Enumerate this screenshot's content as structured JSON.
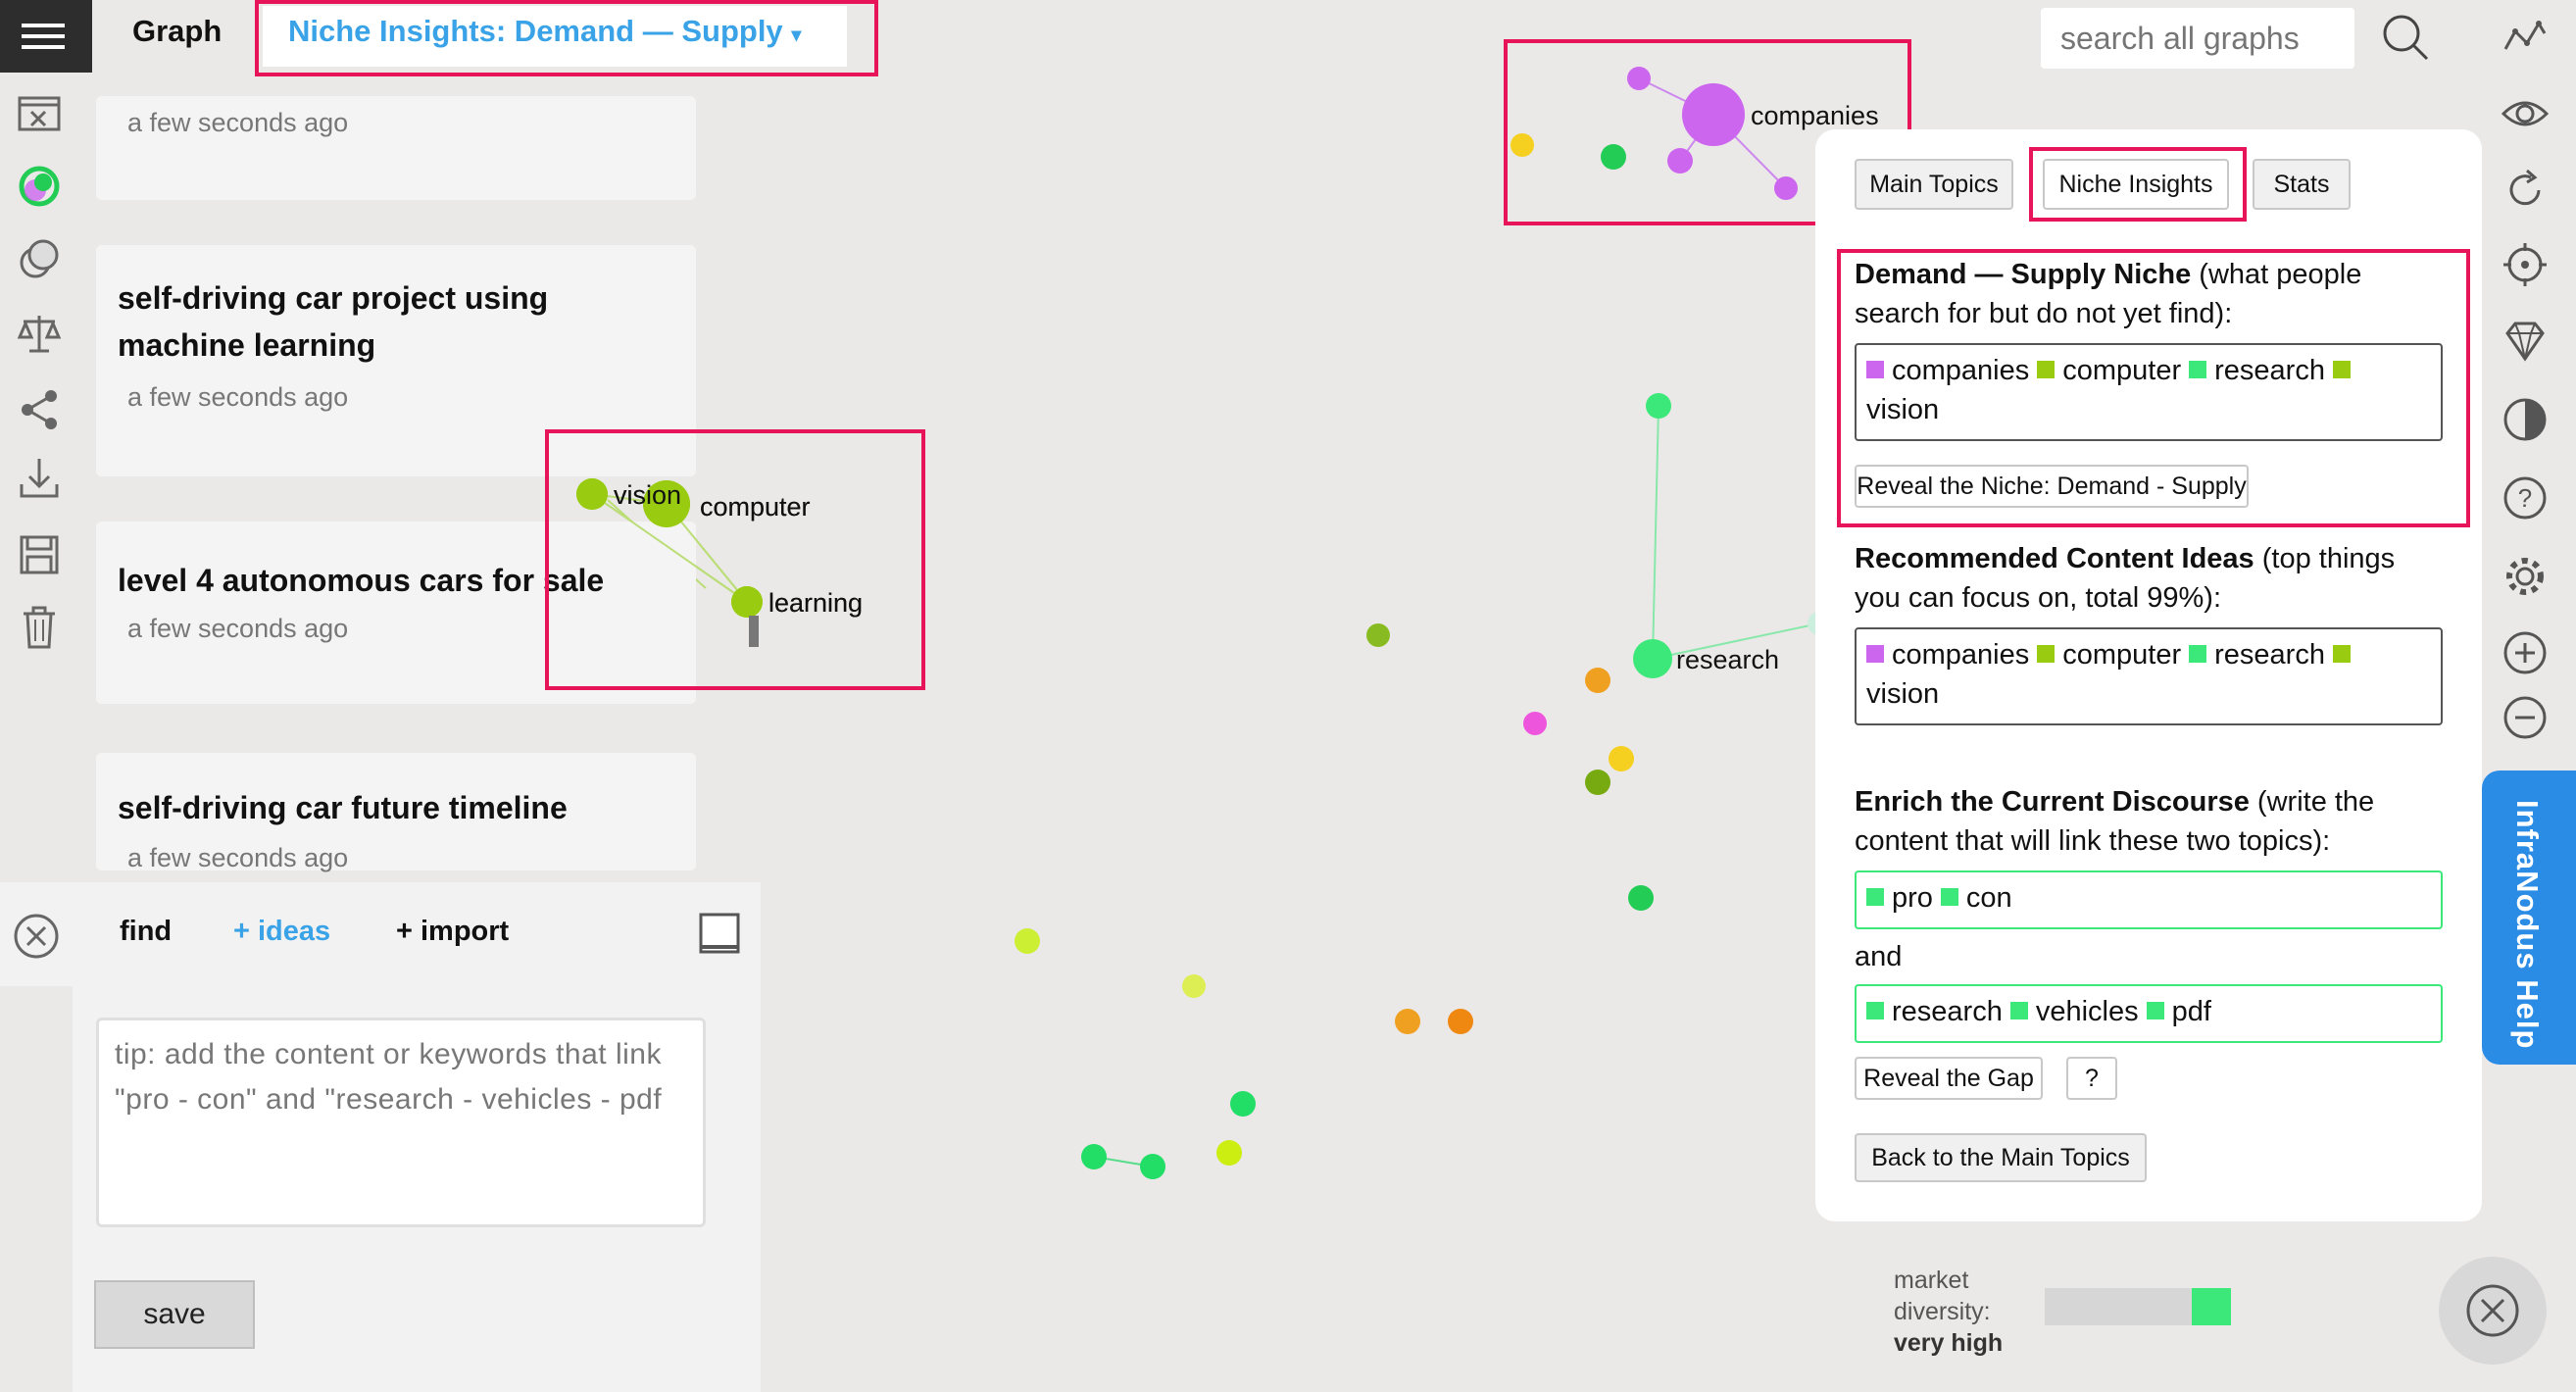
{
  "header": {
    "graph_label": "Graph",
    "graph_title": "Niche Insights: Demand — Supply",
    "search_placeholder": "search all graphs"
  },
  "cards": [
    {
      "title": "",
      "time": "a few seconds ago"
    },
    {
      "title_line1": "self-driving car project using",
      "title_line2": "machine learning",
      "time": "a few seconds ago"
    },
    {
      "title": "level 4 autonomous cars for sale",
      "time": "a few seconds ago"
    },
    {
      "title": "self-driving car future timeline",
      "time": "a few seconds ago"
    }
  ],
  "editor": {
    "tab_find": "find",
    "tab_ideas": "+ ideas",
    "tab_import": "+ import",
    "tip": "tip: add the content or keywords that link \"pro - con\" and \"research - vehicles - pdf",
    "save_label": "save"
  },
  "graph": {
    "labels": {
      "companies": "companies",
      "vision": "vision",
      "computer": "computer",
      "learning": "learning",
      "research": "research"
    }
  },
  "panel": {
    "tabs": [
      "Main Topics",
      "Niche Insights",
      "Stats"
    ],
    "niche_heading": "Demand — Supply Niche",
    "niche_desc_1": " (what people",
    "niche_desc_2": "search for but do not yet find):",
    "niche_tags": [
      "companies",
      "computer",
      "research",
      "vision"
    ],
    "reveal_niche_btn": "Reveal the Niche: Demand - Supply",
    "recommended_heading": "Recommended Content Ideas",
    "recommended_desc_1": " (top things",
    "recommended_desc_2": "you can focus on, total 99%):",
    "recommended_tags": [
      "companies",
      "computer",
      "research",
      "vision"
    ],
    "enrich_heading": "Enrich the Current Discourse",
    "enrich_desc_1": " (write the",
    "enrich_desc_2": "content that will link these two topics):",
    "gap_a": [
      "pro",
      "con"
    ],
    "and_label": "and",
    "gap_b": [
      "research",
      "vehicles",
      "pdf"
    ],
    "reveal_gap_btn": "Reveal the Gap",
    "question_btn": "?",
    "back_btn": "Back to the Main Topics"
  },
  "help_tab": "InfraNodus Help",
  "diversity": {
    "label_line1": "market",
    "label_line2": "diversity:",
    "value": "very high",
    "level": 0.21
  },
  "colors": {
    "accent": "#3aa3e8",
    "highlight": "#e8145a",
    "purple": "#cc66ee",
    "lime": "#99cc11",
    "green": "#3de87a",
    "orange": "#f0a020",
    "yellow": "#f5d020",
    "help": "#2b8ce6"
  },
  "icons": {
    "left": [
      "menu-icon",
      "close-window-icon",
      "color-circle-icon",
      "overlap-icon",
      "balance-icon",
      "share-icon",
      "download-icon",
      "save-icon",
      "trash-icon"
    ],
    "right": [
      "graph-line-icon",
      "eye-icon",
      "refresh-icon",
      "target-icon",
      "diamond-icon",
      "contrast-icon",
      "help-icon",
      "settings-icon",
      "zoom-in-icon",
      "zoom-out-icon"
    ]
  }
}
